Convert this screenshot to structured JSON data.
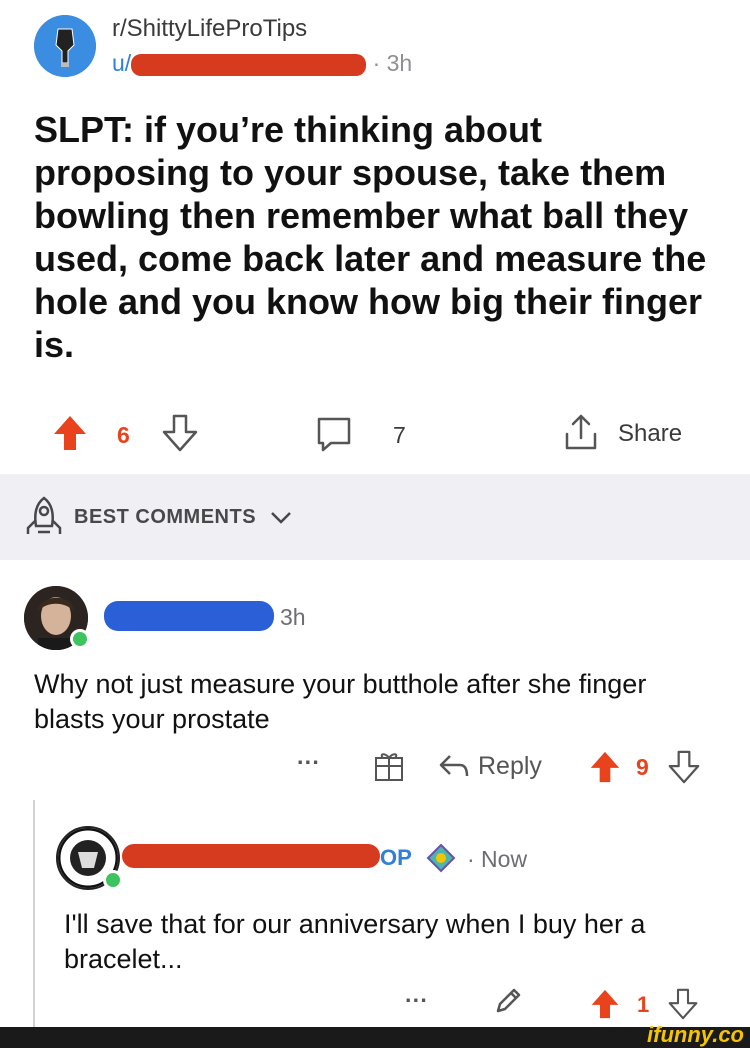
{
  "post": {
    "subreddit": "r/ShittyLifeProTips",
    "user_prefix": "u/",
    "time": "· 3h",
    "title": "SLPT: if you’re thinking about proposing to your spouse, take them bowling then remember what ball they used, come back later and measure the hole and you know how big their finger is.",
    "upvotes": "6",
    "comments": "7",
    "share_label": "Share"
  },
  "sort": {
    "label": "BEST COMMENTS"
  },
  "comment1": {
    "time": "3h",
    "text": "Why not just measure your butthole after she finger blasts your prostate",
    "more": "···",
    "reply_label": "Reply",
    "votes": "9"
  },
  "comment2": {
    "op_badge": "OP",
    "time": "· Now",
    "text": "I'll save that for our anniversary when I buy her a bracelet...",
    "more": "···",
    "votes": "1"
  },
  "watermark": "ifunny.co",
  "colors": {
    "upvote": "#e8431c",
    "redaction_red": "#d63a1f",
    "redaction_blue": "#2a5fd8",
    "online": "#3ec45f"
  }
}
